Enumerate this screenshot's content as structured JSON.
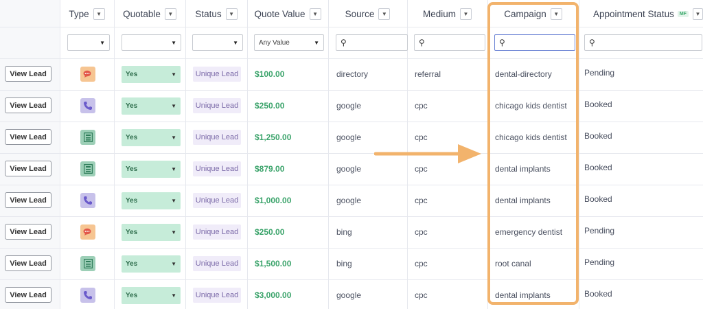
{
  "columns": {
    "type": "Type",
    "quotable": "Quotable",
    "status": "Status",
    "quote_value": "Quote Value",
    "source": "Source",
    "medium": "Medium",
    "campaign": "Campaign",
    "appointment_status": "Appointment Status",
    "appointment_badge": "MF"
  },
  "filters": {
    "quote_value_placeholder": "Any Value"
  },
  "view_lead_label": "View Lead",
  "rows": [
    {
      "type": "chat",
      "quotable": "Yes",
      "status": "Unique Lead",
      "value": "$100.00",
      "source": "directory",
      "medium": "referral",
      "campaign": "dental-directory",
      "appointment": "Pending"
    },
    {
      "type": "phone",
      "quotable": "Yes",
      "status": "Unique Lead",
      "value": "$250.00",
      "source": "google",
      "medium": "cpc",
      "campaign": "chicago kids dentist",
      "appointment": "Booked"
    },
    {
      "type": "form",
      "quotable": "Yes",
      "status": "Unique Lead",
      "value": "$1,250.00",
      "source": "google",
      "medium": "cpc",
      "campaign": "chicago kids dentist",
      "appointment": "Booked"
    },
    {
      "type": "form",
      "quotable": "Yes",
      "status": "Unique Lead",
      "value": "$879.00",
      "source": "google",
      "medium": "cpc",
      "campaign": "dental implants",
      "appointment": "Booked"
    },
    {
      "type": "phone",
      "quotable": "Yes",
      "status": "Unique Lead",
      "value": "$1,000.00",
      "source": "google",
      "medium": "cpc",
      "campaign": "dental implants",
      "appointment": "Booked"
    },
    {
      "type": "chat",
      "quotable": "Yes",
      "status": "Unique Lead",
      "value": "$250.00",
      "source": "bing",
      "medium": "cpc",
      "campaign": "emergency dentist",
      "appointment": "Pending"
    },
    {
      "type": "form",
      "quotable": "Yes",
      "status": "Unique Lead",
      "value": "$1,500.00",
      "source": "bing",
      "medium": "cpc",
      "campaign": "root canal",
      "appointment": "Pending"
    },
    {
      "type": "phone",
      "quotable": "Yes",
      "status": "Unique Lead",
      "value": "$3,000.00",
      "source": "google",
      "medium": "cpc",
      "campaign": "dental implants",
      "appointment": "Booked"
    }
  ],
  "colors": {
    "highlight": "#f2b36c",
    "quote_value": "#3aa36a",
    "quotable_bg": "#c6ecd9",
    "status_bg": "#f0ecf9"
  }
}
